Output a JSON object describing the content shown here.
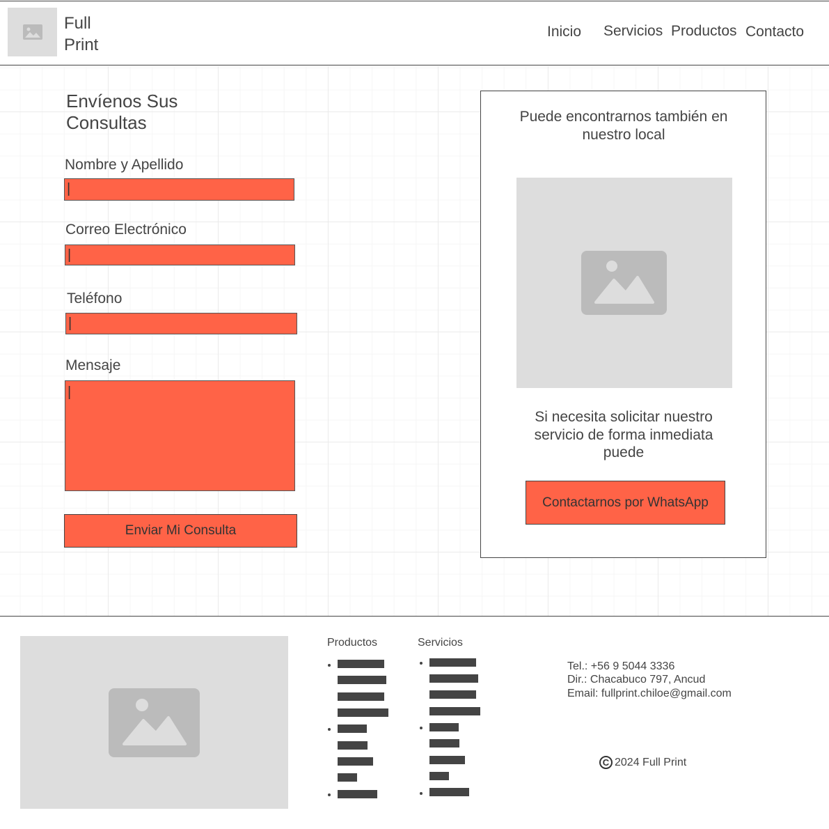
{
  "header": {
    "brand": "Full Print",
    "nav": [
      "Inicio",
      "Servicios",
      "Productos",
      "Contacto"
    ]
  },
  "form": {
    "title": "Envíenos Sus Consultas",
    "fields": [
      {
        "label": "Nombre y Apellido",
        "value": "|"
      },
      {
        "label": "Correo Electrónico",
        "value": "|"
      },
      {
        "label": "Teléfono",
        "value": "|"
      },
      {
        "label": "Mensaje",
        "value": "|"
      }
    ],
    "submit_label": "Enviar Mi Consulta"
  },
  "side": {
    "location_text": "Puede encontrarnos también en nuestro local",
    "urgent_text": "Si necesita solicitar nuestro servicio de forma inmediata puede",
    "whatsapp_label": "Contactarnos por WhatsApp"
  },
  "footer": {
    "products_title": "Productos",
    "services_title": "Servicios",
    "tel": "Tel.: +56 9 5044 3336",
    "dir": "Dir.: Chacabuco 797, Ancud",
    "email": "Email: fullprint.chiloe@gmail.com",
    "copyright_symbol": "©",
    "copyright": "2024 Full Print"
  },
  "icons": {
    "logo": "image-placeholder-icon",
    "local_photo": "image-placeholder-icon",
    "footer_photo": "image-placeholder-icon"
  },
  "colors": {
    "accent": "#ff6347",
    "placeholder": "#dddddd",
    "icon": "#bbbbbb",
    "text": "#444444"
  }
}
